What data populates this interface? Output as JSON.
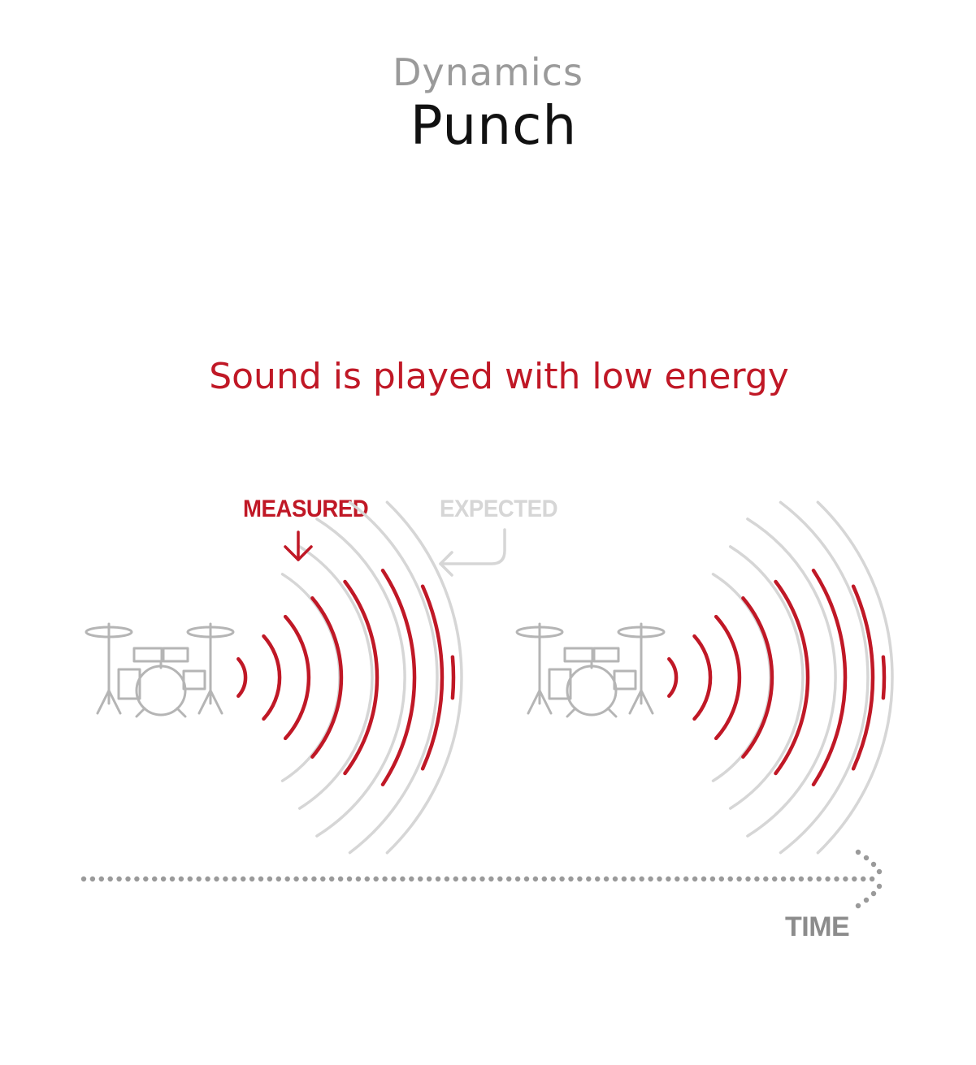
{
  "header": {
    "category": "Dynamics",
    "title": "Punch"
  },
  "caption": "Sound is played with low energy",
  "labels": {
    "measured": "MEASURED",
    "expected": "EXPECTED",
    "time": "TIME"
  },
  "colors": {
    "measured": "#c01826",
    "expected": "#d6d6d6",
    "drum": "#b5b5b5",
    "arrow": "#9a9a9a",
    "title": "#111111",
    "category": "#9a9a9a"
  },
  "icons": [
    "drum-kit-icon",
    "measured-arrow-icon",
    "expected-arrow-icon",
    "time-arrow-icon"
  ]
}
